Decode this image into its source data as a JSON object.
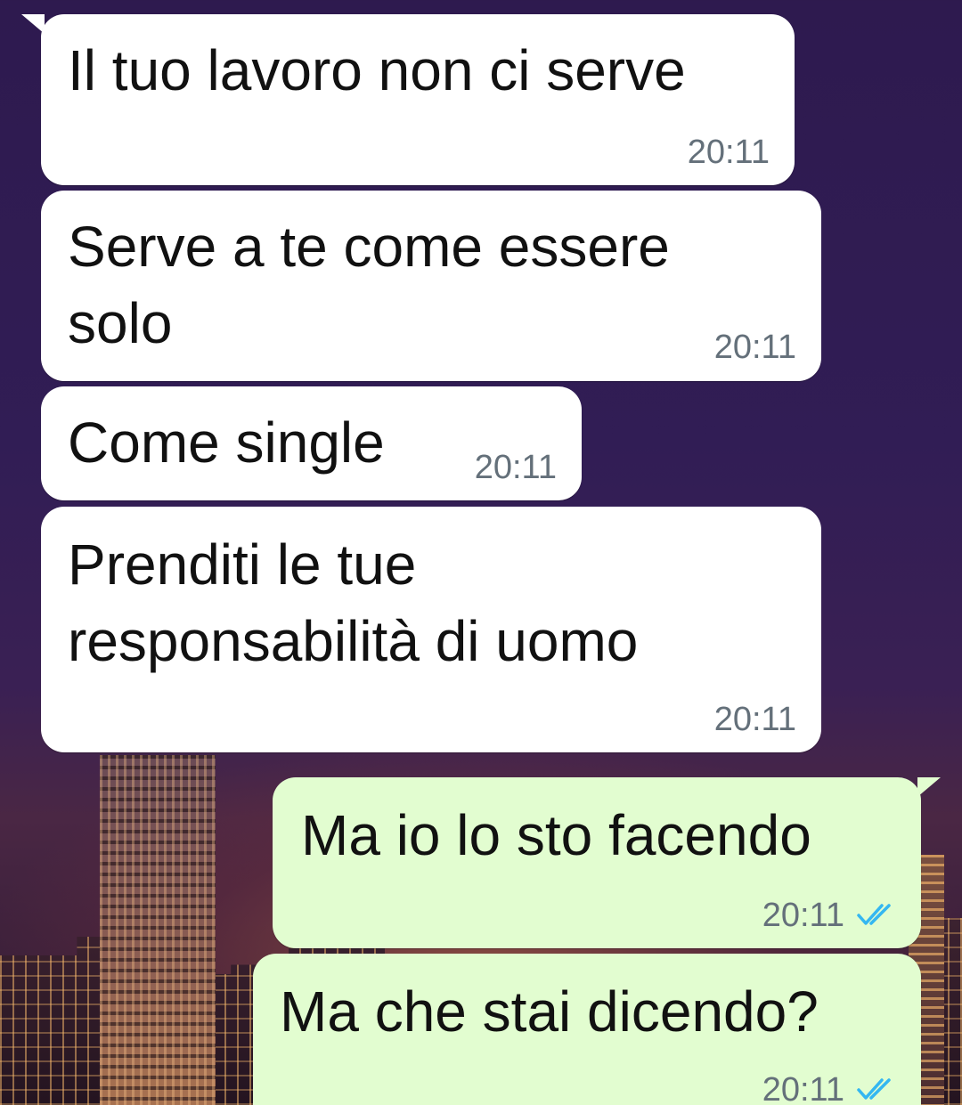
{
  "theme": {
    "incoming_bubble": "#ffffff",
    "outgoing_bubble": "#e2fdd0",
    "text": "#111111",
    "timestamp": "#64707a",
    "read_ticks": "#34b7f1"
  },
  "messages": [
    {
      "direction": "incoming",
      "text": "Il tuo lavoro non ci serve",
      "time": "20:11"
    },
    {
      "direction": "incoming",
      "text": "Serve a te come essere\nsolo",
      "time": "20:11"
    },
    {
      "direction": "incoming",
      "text": "Come single",
      "time": "20:11"
    },
    {
      "direction": "incoming",
      "text": "Prenditi le tue\nresponsabilità di uomo",
      "time": "20:11"
    },
    {
      "direction": "outgoing",
      "text": "Ma io lo sto facendo",
      "time": "20:11",
      "status_icon": "double-check-read-icon"
    },
    {
      "direction": "outgoing",
      "text": "Ma che stai dicendo?",
      "time": "20:11",
      "status_icon": "double-check-read-icon"
    }
  ]
}
